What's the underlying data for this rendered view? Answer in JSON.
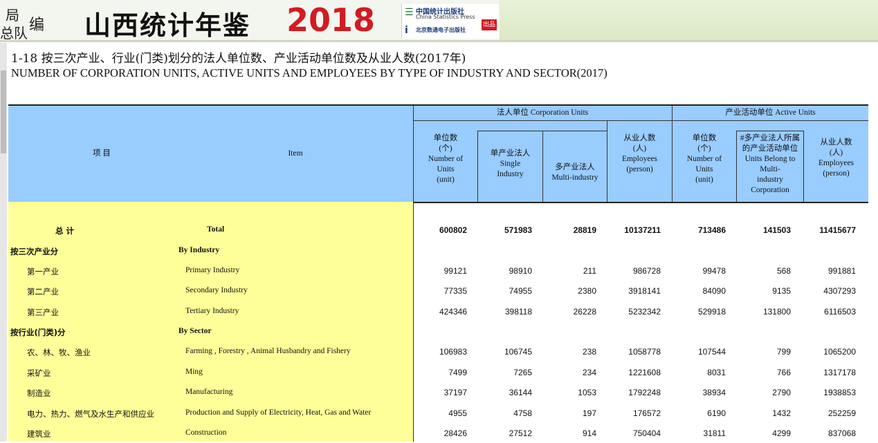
{
  "banner": {
    "left_top": "局",
    "left_bottom": "总队",
    "left_mid": "编",
    "title": "山西统计年鉴",
    "year": "2018",
    "publisher_1": "中国统计出版社",
    "publisher_1_en": "China Statistics Press",
    "publisher_2": "北京数通电子出版社",
    "stamp": "出品"
  },
  "document": {
    "title_cn": "1-18   按三次产业、行业(门类)划分的法人单位数、产业活动单位数及从业人数(2017年)",
    "title_en": "NUMBER OF CORPORATION UNITS, ACTIVE UNITS AND EMPLOYEES BY TYPE OF INDUSTRY AND SECTOR(2017)"
  },
  "table": {
    "header": {
      "item_cn": "项      目",
      "item_en": "Item",
      "corp_group": "法人单位      Corporation Units",
      "active_group": "产业活动单位      Active Units",
      "columns": [
        [
          "单位数",
          "(个)",
          "Number of",
          "Units",
          "(unit)"
        ],
        [
          "单产业法人",
          "Single",
          "Industry"
        ],
        [
          "多产业法人",
          "Multi-industry"
        ],
        [
          "从业人数",
          "(人)",
          "Employees",
          "(person)"
        ],
        [
          "单位数",
          "(个)",
          "Number of",
          "Units",
          "(unit)"
        ],
        [
          "#多产业法人所属",
          "的产业活动单位",
          "Units Belong to",
          "Multi-",
          "industry",
          "Corporation"
        ],
        [
          "从业人数",
          "(人)",
          "Employees",
          "(person)"
        ]
      ]
    },
    "rows": [
      {
        "cn": "总          计",
        "en": "Total",
        "values": [
          "600802",
          "571983",
          "28819",
          "10137211",
          "713486",
          "141503",
          "11415677"
        ],
        "kind": "total"
      },
      {
        "cn": "按三次产业分",
        "en": "By Industry",
        "values": [],
        "kind": "section"
      },
      {
        "cn": "第一产业",
        "en": "Primary Industry",
        "values": [
          "99121",
          "98910",
          "211",
          "986728",
          "99478",
          "568",
          "991881"
        ],
        "kind": "item"
      },
      {
        "cn": "第二产业",
        "en": "Secondary Industry",
        "values": [
          "77335",
          "74955",
          "2380",
          "3918141",
          "84090",
          "9135",
          "4307293"
        ],
        "kind": "item"
      },
      {
        "cn": "第三产业",
        "en": "Tertiary Industry",
        "values": [
          "424346",
          "398118",
          "26228",
          "5232342",
          "529918",
          "131800",
          "6116503"
        ],
        "kind": "item"
      },
      {
        "cn": "按行业(门类)分",
        "en": "By Sector",
        "values": [],
        "kind": "section"
      },
      {
        "cn": "农、林、牧、渔业",
        "en": "Farming , Forestry , Animal Husbandry and Fishery",
        "values": [
          "106983",
          "106745",
          "238",
          "1058778",
          "107544",
          "799",
          "1065200"
        ],
        "kind": "item"
      },
      {
        "cn": "采矿业",
        "en": "Ming",
        "values": [
          "7499",
          "7265",
          "234",
          "1221608",
          "8031",
          "766",
          "1317178"
        ],
        "kind": "item"
      },
      {
        "cn": "制造业",
        "en": "Manufacturing",
        "values": [
          "37197",
          "36144",
          "1053",
          "1792248",
          "38934",
          "2790",
          "1938853"
        ],
        "kind": "item"
      },
      {
        "cn": "电力、热力、燃气及水生产和供应业",
        "en": "Production and Supply of Electricity, Heat, Gas and Water",
        "values": [
          "4955",
          "4758",
          "197",
          "176572",
          "6190",
          "1432",
          "252259"
        ],
        "kind": "item"
      },
      {
        "cn": "建筑业",
        "en": "Construction",
        "values": [
          "28426",
          "27512",
          "914",
          "750404",
          "31811",
          "4299",
          "837068"
        ],
        "kind": "item"
      }
    ]
  }
}
